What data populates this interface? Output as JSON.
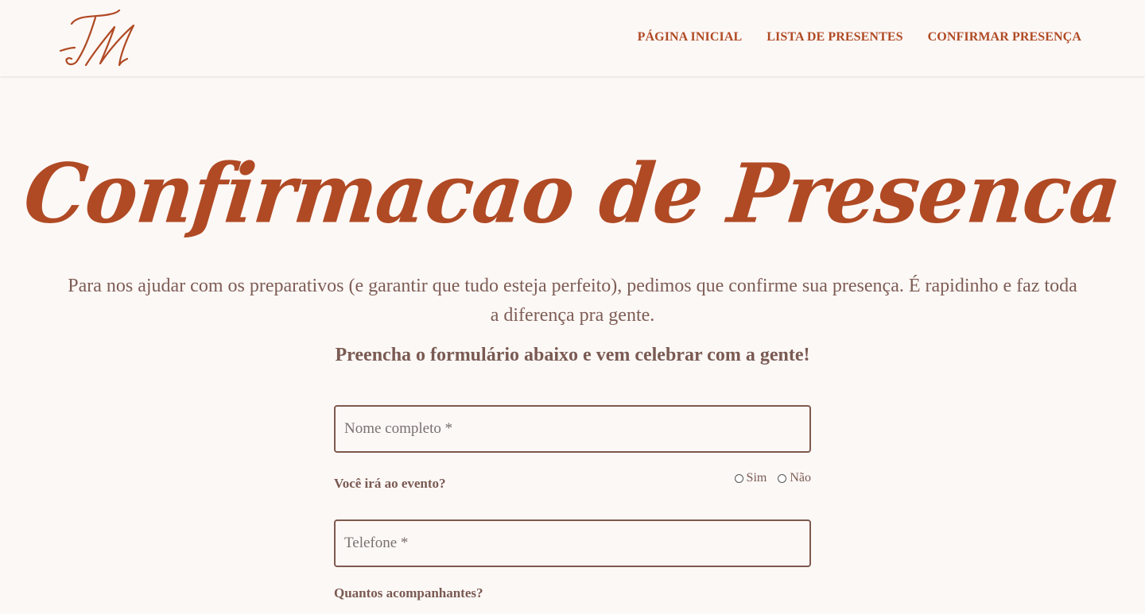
{
  "header": {
    "logo_monogram": "TM",
    "nav": [
      {
        "label": "PÁGINA INICIAL"
      },
      {
        "label": "LISTA DE PRESENTES"
      },
      {
        "label": "CONFIRMAR PRESENÇA"
      }
    ]
  },
  "main": {
    "title": "Confirmacao de Presenca",
    "intro": "Para nos ajudar com os preparativos (e garantir que tudo esteja perfeito), pedimos que confirme sua presença. É rapidinho e faz toda a diferença pra gente.",
    "cta": "Preencha o formulário abaixo e vem celebrar com a gente!"
  },
  "form": {
    "name_placeholder": "Nome completo *",
    "attend_question": "Você irá ao evento?",
    "attend_options": [
      {
        "label": "Sim"
      },
      {
        "label": "Não"
      }
    ],
    "phone_placeholder": "Telefone *",
    "guests_question": "Quantos acompanhantes?"
  },
  "colors": {
    "accent": "#b04a24",
    "text": "#7e5d55",
    "background": "#fcf8f6",
    "border": "#7e5a4e"
  }
}
